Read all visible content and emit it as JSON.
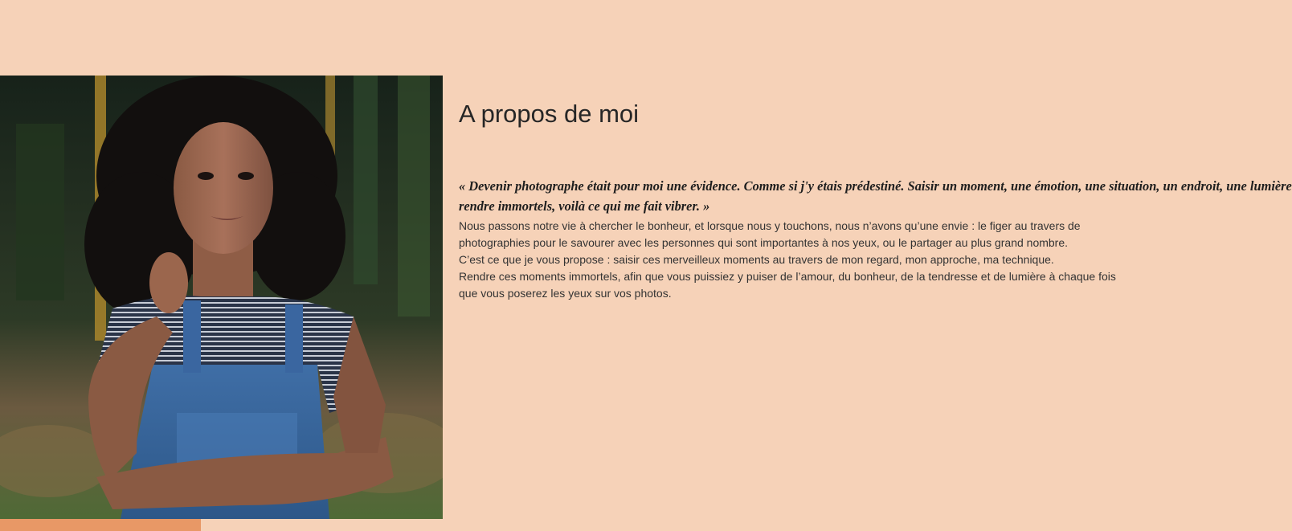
{
  "colors": {
    "background": "#f6d2b8",
    "accent_bar": "#e89866",
    "heading_text": "#262626"
  },
  "photo": {
    "subject": "portrait-woman-curly-hair-denim-overalls",
    "icon": "portrait-photo"
  },
  "about": {
    "title": "A propos de moi",
    "quote_lines": [
      "« Devenir photographe était pour moi une évidence. Comme si j'y étais prédestiné. Saisir un moment, une émotion, une situation, un endroit, une lumière et les",
      "rendre immortels, voilà ce qui me fait vibrer. »"
    ],
    "body_lines": [
      "Nous passons notre vie à chercher le bonheur, et lorsque nous y touchons, nous n’avons qu’une envie : le figer au travers de",
      "photographies pour le savourer avec les personnes qui sont importantes à nos yeux, ou le partager au plus grand nombre.",
      "C’est ce que je vous propose : saisir ces merveilleux moments au travers de mon regard, mon approche, ma technique.",
      "Rendre ces moments immortels, afin que vous puissiez y puiser de l’amour, du bonheur, de la tendresse et de lumière à chaque fois",
      "que vous poserez les yeux sur vos photos."
    ]
  }
}
